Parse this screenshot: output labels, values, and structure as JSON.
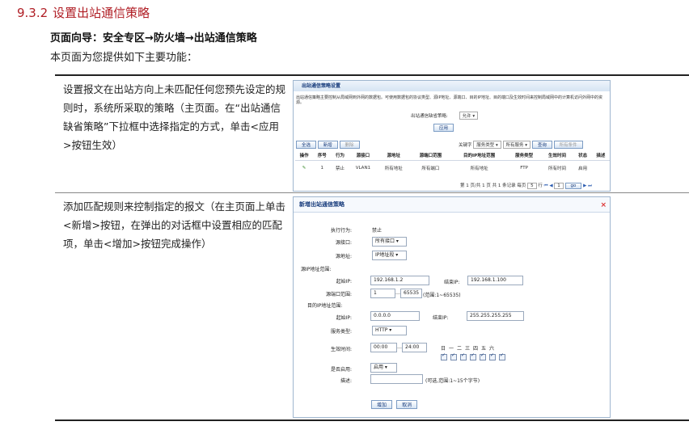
{
  "section": {
    "number": "9.3.2",
    "title": "设置出站通信策略"
  },
  "nav_path": "页面向导：安全专区→防火墙→出站通信策略",
  "intro": "本页面为您提供如下主要功能：",
  "rows": [
    {
      "description": "设置报文在出站方向上未匹配任何您预先设定的规则时，系统所采取的策略（主页面。在“出站通信缺省策略”下拉框中选择指定的方式，单击<应用>按钮生效）"
    },
    {
      "description": "添加匹配规则来控制指定的报文（在主页面上单击<新增>按钮，在弹出的对话框中设置相应的匹配项，单击<增加>按钮完成操作）"
    }
  ],
  "screenshot1": {
    "title": "出站通信策略设置",
    "note": "出站通信策略主要控制从局域网到外网的数据包。可使用数据包的协议类型、源IP地址、源端口、目的IP地址、目的端口及生效时间来控制局域网中的计算机访问外网中的资源。",
    "default_policy_label": "出站通信缺省策略:",
    "default_policy_value": "允许",
    "apply": "应用",
    "toolbar": {
      "select_all": "全选",
      "add": "新增",
      "delete": "删除",
      "keyword_label": "关键字",
      "keyword_value": "服务类型",
      "service_value": "所有服务",
      "search": "查询",
      "reset": "所有条件"
    },
    "columns": [
      "操作",
      "序号",
      "行为",
      "源接口",
      "源地址",
      "源端口范围",
      "目的IP地址范围",
      "服务类型",
      "生效时间",
      "状态",
      "描述"
    ],
    "row": {
      "seq": "1",
      "action": "禁止",
      "iface": "VLAN1",
      "src": "所有地址",
      "sport": "所有端口",
      "dst": "所有地址",
      "service": "FTP",
      "time": "所有时间",
      "status": "启用",
      "desc": ""
    },
    "pagination": "第 1 页/共 1 页 共 1 条记录 每页",
    "page_size": "5",
    "page_size_unit": "行",
    "page_input": "1",
    "go": "go"
  },
  "screenshot2": {
    "title": "新增出站通信策略",
    "close": "×",
    "fields": {
      "action_label": "执行行为:",
      "action_value": "禁止",
      "iface_label": "源接口:",
      "iface_value": "所有接口",
      "src_label": "源地址:",
      "src_value": "IP地址段",
      "src_range_label": "源IP地址范围:",
      "start_ip_label": "起始IP:",
      "start_ip_value": "192.168.1.2",
      "end_ip_label": "结束IP:",
      "end_ip_value": "192.168.1.100",
      "sport_label": "源端口范围:",
      "sport_from": "1",
      "sport_to": "65535",
      "sport_hint": "(范围:1~65535)",
      "dst_range_label": "目的IP地址范围:",
      "dst_start_label": "起始IP:",
      "dst_start_value": "0.0.0.0",
      "dst_end_label": "结束IP:",
      "dst_end_value": "255.255.255.255",
      "service_label": "服务类型:",
      "service_value": "HTTP",
      "time_label": "生效时间:",
      "time_from": "00:00",
      "time_to": "24:00",
      "days": [
        "日",
        "一",
        "二",
        "三",
        "四",
        "五",
        "六"
      ],
      "enable_label": "是否启用:",
      "enable_value": "启用",
      "desc_label": "描述:",
      "desc_hint": "(可选,范围:1~15个字节)"
    },
    "add": "增加",
    "cancel": "取消"
  }
}
